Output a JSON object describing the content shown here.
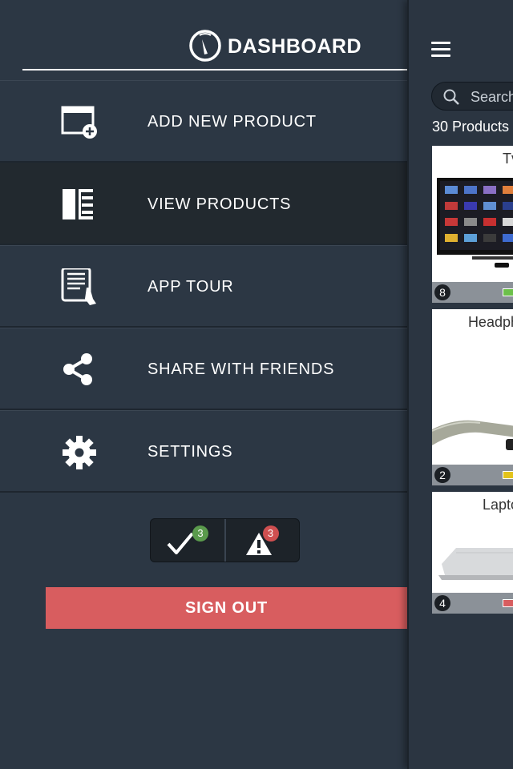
{
  "header": {
    "title": "DASHBOARD",
    "icon": "speedometer-icon"
  },
  "menu": {
    "items": [
      {
        "label": "ADD NEW PRODUCT",
        "icon": "add-window-icon"
      },
      {
        "label": "VIEW PRODUCTS",
        "icon": "list-view-icon",
        "active": true
      },
      {
        "label": "APP TOUR",
        "icon": "tablet-tap-icon"
      },
      {
        "label": "SHARE WITH FRIENDS",
        "icon": "share-icon"
      },
      {
        "label": "SETTINGS",
        "icon": "gear-icon"
      }
    ]
  },
  "badges": {
    "checked": {
      "count": "3",
      "icon": "checkmark-icon",
      "color": "#5a9a4c"
    },
    "warnings": {
      "count": "3",
      "icon": "warning-icon",
      "color": "#cf4f50"
    }
  },
  "signout": {
    "label": "SIGN OUT",
    "color": "#d85d5f"
  },
  "panel": {
    "search": {
      "placeholder": "Search"
    },
    "count_label": "30 Products",
    "products": [
      {
        "title": "Tv",
        "count": "8",
        "status_color": "#6cc04a"
      },
      {
        "title": "Headph",
        "count": "2",
        "status_color": "#e3c31b"
      },
      {
        "title": "Lapto",
        "count": "4",
        "status_color": "#d85d5f"
      }
    ]
  }
}
